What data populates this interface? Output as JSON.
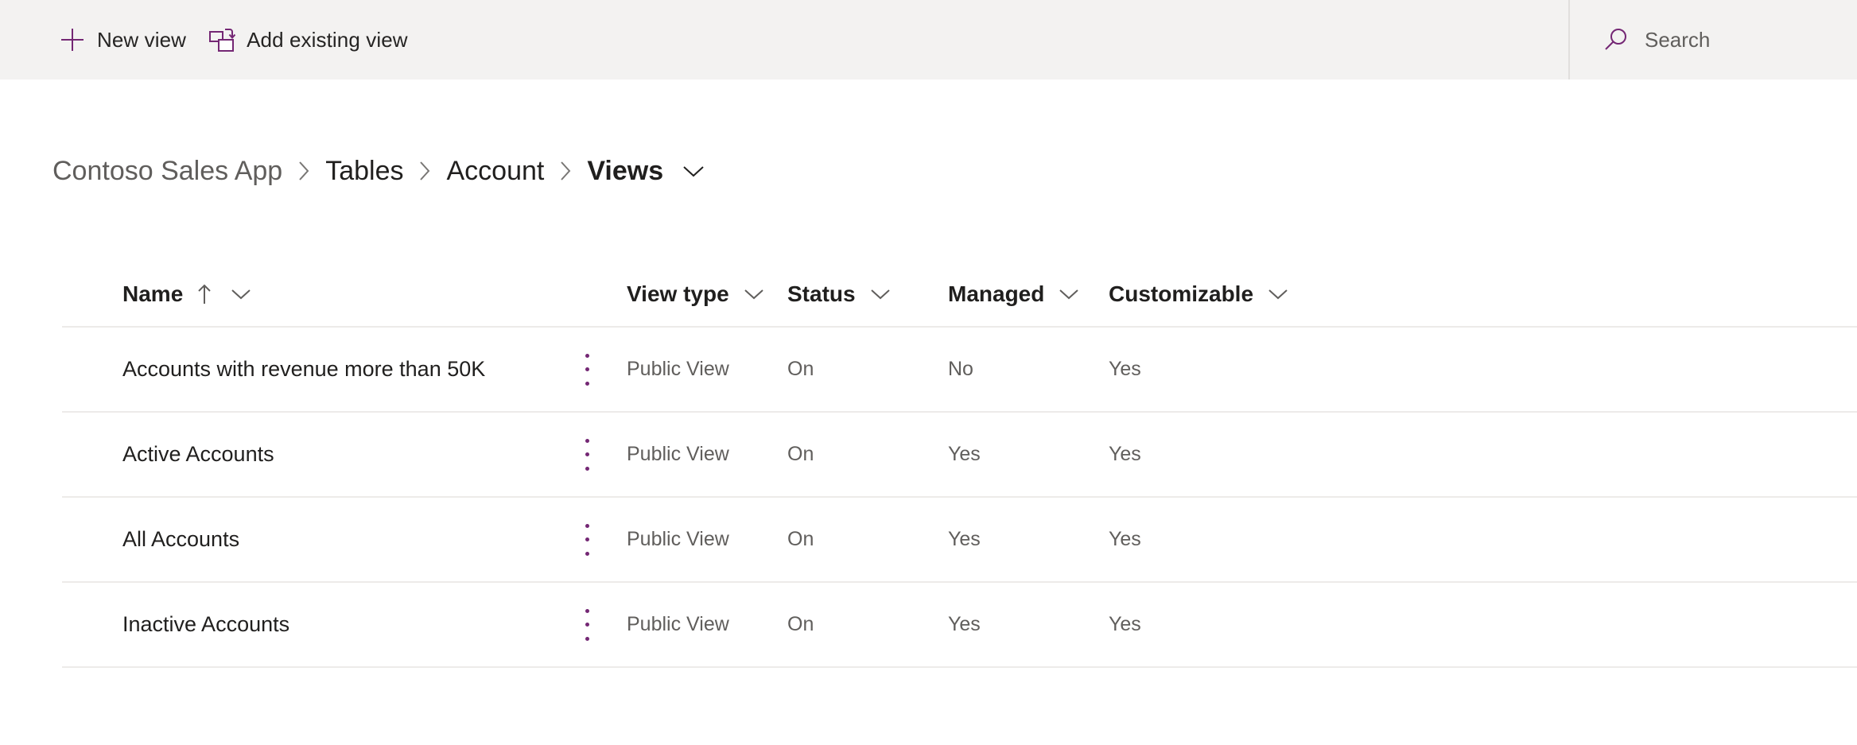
{
  "command_bar": {
    "buttons": [
      {
        "label": "New view",
        "icon": "plus-icon"
      },
      {
        "label": "Add existing view",
        "icon": "add-existing-view-icon"
      }
    ]
  },
  "search": {
    "icon": "search-icon",
    "placeholder": "Search",
    "value": ""
  },
  "breadcrumb": {
    "items": [
      {
        "label": "Contoso Sales App",
        "style": "muted"
      },
      {
        "label": "Tables",
        "style": "strong"
      },
      {
        "label": "Account",
        "style": "strong"
      },
      {
        "label": "Views",
        "style": "current"
      }
    ],
    "separator": "›",
    "chevron_icon": "chevron-down-icon"
  },
  "table": {
    "columns": [
      {
        "key": "name",
        "label": "Name",
        "sort": "ascending",
        "sort_icon": "arrow-up-icon",
        "filter_icon": "chevron-down-icon"
      },
      {
        "key": "view_type",
        "label": "View type",
        "filter_icon": "chevron-down-icon"
      },
      {
        "key": "status",
        "label": "Status",
        "filter_icon": "chevron-down-icon"
      },
      {
        "key": "managed",
        "label": "Managed",
        "filter_icon": "chevron-down-icon"
      },
      {
        "key": "customizable",
        "label": "Customizable",
        "filter_icon": "chevron-down-icon"
      }
    ],
    "row_menu_icon": "more-vertical-icon",
    "rows": [
      {
        "name": "Accounts with revenue more than 50K",
        "view_type": "Public View",
        "status": "On",
        "managed": "No",
        "customizable": "Yes"
      },
      {
        "name": "Active Accounts",
        "view_type": "Public View",
        "status": "On",
        "managed": "Yes",
        "customizable": "Yes"
      },
      {
        "name": "All Accounts",
        "view_type": "Public View",
        "status": "On",
        "managed": "Yes",
        "customizable": "Yes"
      },
      {
        "name": "Inactive Accounts",
        "view_type": "Public View",
        "status": "On",
        "managed": "Yes",
        "customizable": "Yes"
      }
    ]
  },
  "colors": {
    "accent_purple": "#742774",
    "command_bar_bg": "#f3f2f1",
    "text_primary": "#201f1e",
    "text_secondary": "#605e5c",
    "divider": "#edebe9"
  }
}
